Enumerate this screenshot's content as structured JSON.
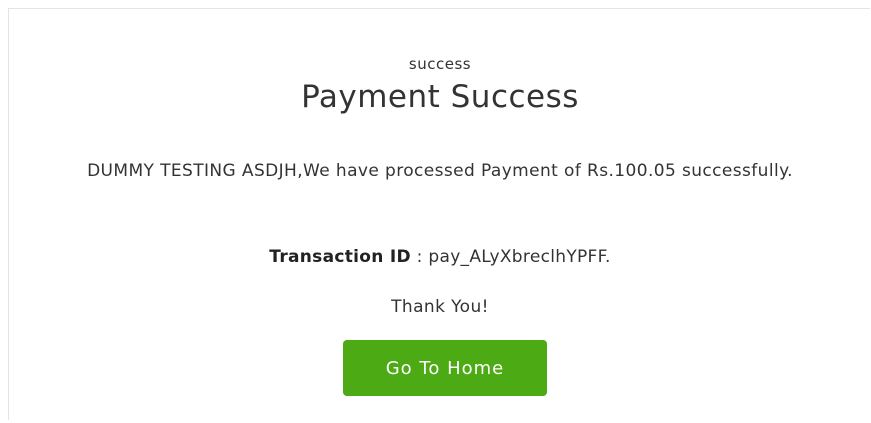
{
  "status": {
    "label": "success"
  },
  "title": "Payment Success",
  "message": {
    "text": "DUMMY TESTING ASDJH,We have processed Payment of Rs.100.05 successfully."
  },
  "transaction": {
    "label": "Transaction ID",
    "separator": " : ",
    "value": "pay_ALyXbreclhYPFF."
  },
  "thanks": "Thank You!",
  "home_button": {
    "label": "Go To Home",
    "color": "#4caa14"
  }
}
